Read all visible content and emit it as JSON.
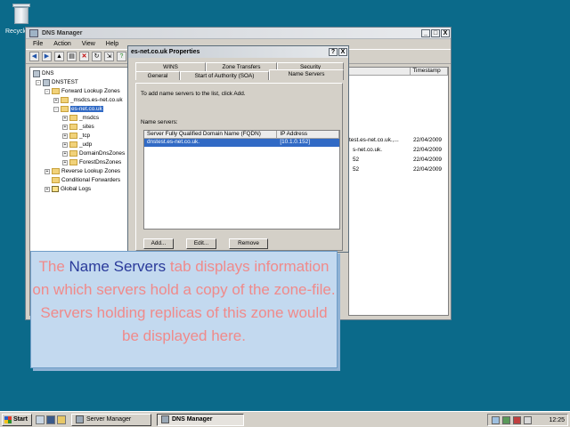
{
  "desktop": {
    "recycle_label": "Recycle"
  },
  "window": {
    "title": "DNS Manager",
    "controls": [
      "_",
      "□",
      "X"
    ],
    "menu": [
      "File",
      "Action",
      "View",
      "Help"
    ],
    "toolbar_icons": [
      "back-icon",
      "forward-icon",
      "up-icon",
      "properties-icon",
      "delete-icon",
      "refresh-icon",
      "export-icon",
      "help-icon"
    ]
  },
  "tree": {
    "root": "DNS",
    "server": "DNSTEST",
    "forward": "Forward Lookup Zones",
    "msdcs": "_msdcs.es-net.co.uk",
    "zone": "es-net.co.uk",
    "children": [
      "_msdcs",
      "_sites",
      "_tcp",
      "_udp",
      "DomainDnsZones",
      "ForestDnsZones"
    ],
    "reverse": "Reverse Lookup Zones",
    "conditional": "Conditional Forwarders",
    "global_logs": "Global Logs"
  },
  "list": {
    "col_timestamp": "Timestamp",
    "rows": [
      {
        "name": "test.es-net.co.uk.,...",
        "ts": "22/04/2009"
      },
      {
        "name": "s-net.co.uk.",
        "ts": "22/04/2009"
      },
      {
        "name": "52",
        "ts": "22/04/2009"
      },
      {
        "name": "52",
        "ts": "22/04/2009"
      }
    ]
  },
  "dialog": {
    "title": "es-net.co.uk Properties",
    "help_btn": "?",
    "close_btn": "X",
    "tabs_row1": [
      "WINS",
      "Zone Transfers",
      "Security"
    ],
    "tabs_row2": [
      "General",
      "Start of Authority (SOA)",
      "Name Servers"
    ],
    "instruction": "To add name servers to the list, click Add.",
    "ns_label": "Name servers:",
    "col_fqdn": "Server Fully Qualified Domain Name (FQDN)",
    "col_ip": "IP Address",
    "ns_rows": [
      {
        "fqdn": "dnstest.es-net.co.uk.",
        "ip": "[10.1.0.152]"
      }
    ],
    "add": "Add...",
    "edit": "Edit...",
    "remove": "Remove"
  },
  "callout": {
    "pre": "The ",
    "highlight": "Name Servers",
    "post": " tab displays information on which servers hold a copy of the zone-file. Servers holding replicas of this zone would be displayed here."
  },
  "taskbar": {
    "start": "Start",
    "tasks": [
      "Server Manager",
      "DNS Manager"
    ],
    "clock": "12:25"
  }
}
